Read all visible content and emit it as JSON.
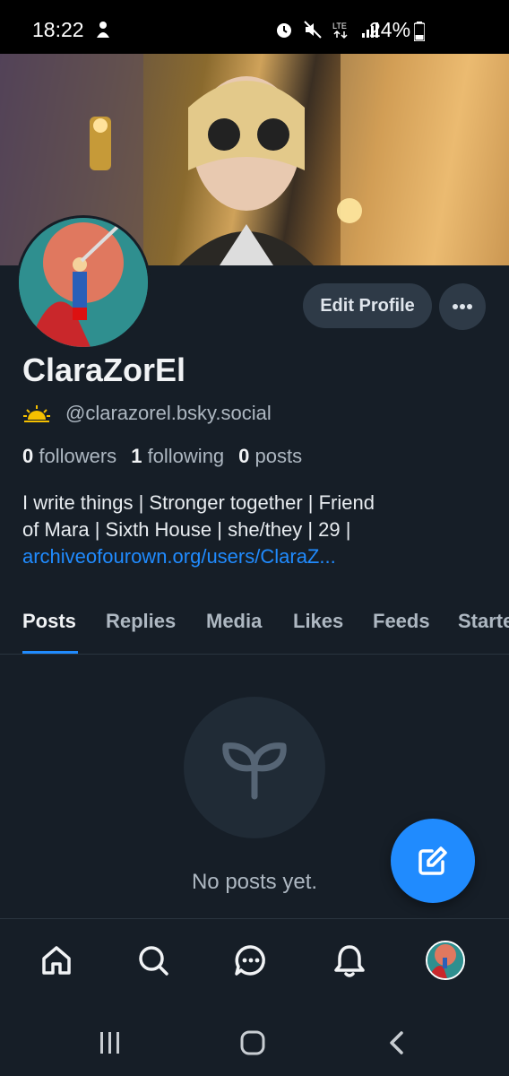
{
  "status_bar": {
    "time": "18:22",
    "battery": "24%"
  },
  "profile": {
    "edit_label": "Edit Profile",
    "display_name": "ClaraZorEl",
    "handle": "@clarazorel.bsky.social",
    "followers_count": "0",
    "followers_label": "followers",
    "following_count": "1",
    "following_label": "following",
    "posts_count": "0",
    "posts_label": "posts",
    "bio_line1": "I write things | Stronger together | Friend",
    "bio_line2": "of Mara | Sixth House | she/they | 29 |",
    "bio_link": "archiveofourown.org/users/ClaraZ..."
  },
  "tabs": [
    {
      "label": "Posts"
    },
    {
      "label": "Replies"
    },
    {
      "label": "Media"
    },
    {
      "label": "Likes"
    },
    {
      "label": "Feeds"
    },
    {
      "label": "Starter"
    }
  ],
  "empty_state": {
    "text": "No posts yet."
  },
  "icons": {
    "status": [
      "alarm-icon",
      "mute-icon",
      "lte-icon",
      "signal-icon",
      "battery-icon"
    ],
    "nav": [
      "home-icon",
      "search-icon",
      "chat-icon",
      "bell-icon"
    ],
    "fab": "compose-icon",
    "empty": "seedling-icon",
    "handle": "sunrise-icon"
  },
  "colors": {
    "background": "#161e27",
    "accent": "#208bfe",
    "muted": "#aeb8c2"
  }
}
